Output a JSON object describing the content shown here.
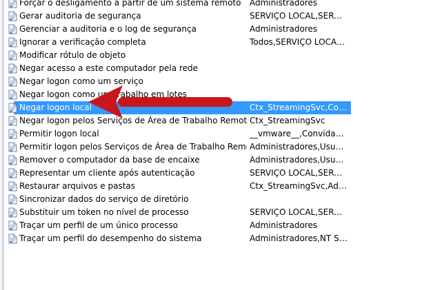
{
  "icons": {
    "policy": "policy-document-icon",
    "arrow": "red-arrow"
  },
  "colors": {
    "selection": "#3399ff",
    "arrow": "#c8161d"
  },
  "rows": [
    {
      "policy": "Forçar o desligamento a partir de um sistema remoto",
      "setting": "Administradores"
    },
    {
      "policy": "Gerar auditoria de segurança",
      "setting": "SERVIÇO LOCAL,SERVIÇ..."
    },
    {
      "policy": "Gerenciar a auditoria e o log de segurança",
      "setting": "Administradores"
    },
    {
      "policy": "Ignorar a verificação completa",
      "setting": "Todos,SERVIÇO LOCAL,..."
    },
    {
      "policy": "Modificar rótulo de objeto",
      "setting": ""
    },
    {
      "policy": "Negar acesso a este computador pela rede",
      "setting": ""
    },
    {
      "policy": "Negar logon como um serviço",
      "setting": ""
    },
    {
      "policy": "Negar logon como um trabalho em lotes",
      "setting": ""
    },
    {
      "policy": "Negar logon local",
      "setting": "Ctx_StreamingSvc,Convi...",
      "selected": true
    },
    {
      "policy": "Negar logon pelos Serviços de Área de Trabalho Remota",
      "setting": "Ctx_StreamingSvc"
    },
    {
      "policy": "Permitir logon local",
      "setting": "__vmware__,Convidado,..."
    },
    {
      "policy": "Permitir logon pelos Serviços de Área de Trabalho Remota",
      "setting": "Administradores,Usuári..."
    },
    {
      "policy": "Remover o computador da base de encaixe",
      "setting": "Administradores,Usuários"
    },
    {
      "policy": "Representar um cliente após autenticação",
      "setting": "SERVIÇO LOCAL,SERVIÇ..."
    },
    {
      "policy": "Restaurar arquivos e pastas",
      "setting": "Ctx_StreamingSvc,Admi..."
    },
    {
      "policy": "Sincronizar dados do serviço de diretório",
      "setting": ""
    },
    {
      "policy": "Substituir um token no nível de processo",
      "setting": "SERVIÇO LOCAL,SERVIÇ..."
    },
    {
      "policy": "Traçar um perfil de um único processo",
      "setting": "Administradores"
    },
    {
      "policy": "Traçar um perfil do desempenho do sistema",
      "setting": "Administradores,NT SER..."
    }
  ]
}
